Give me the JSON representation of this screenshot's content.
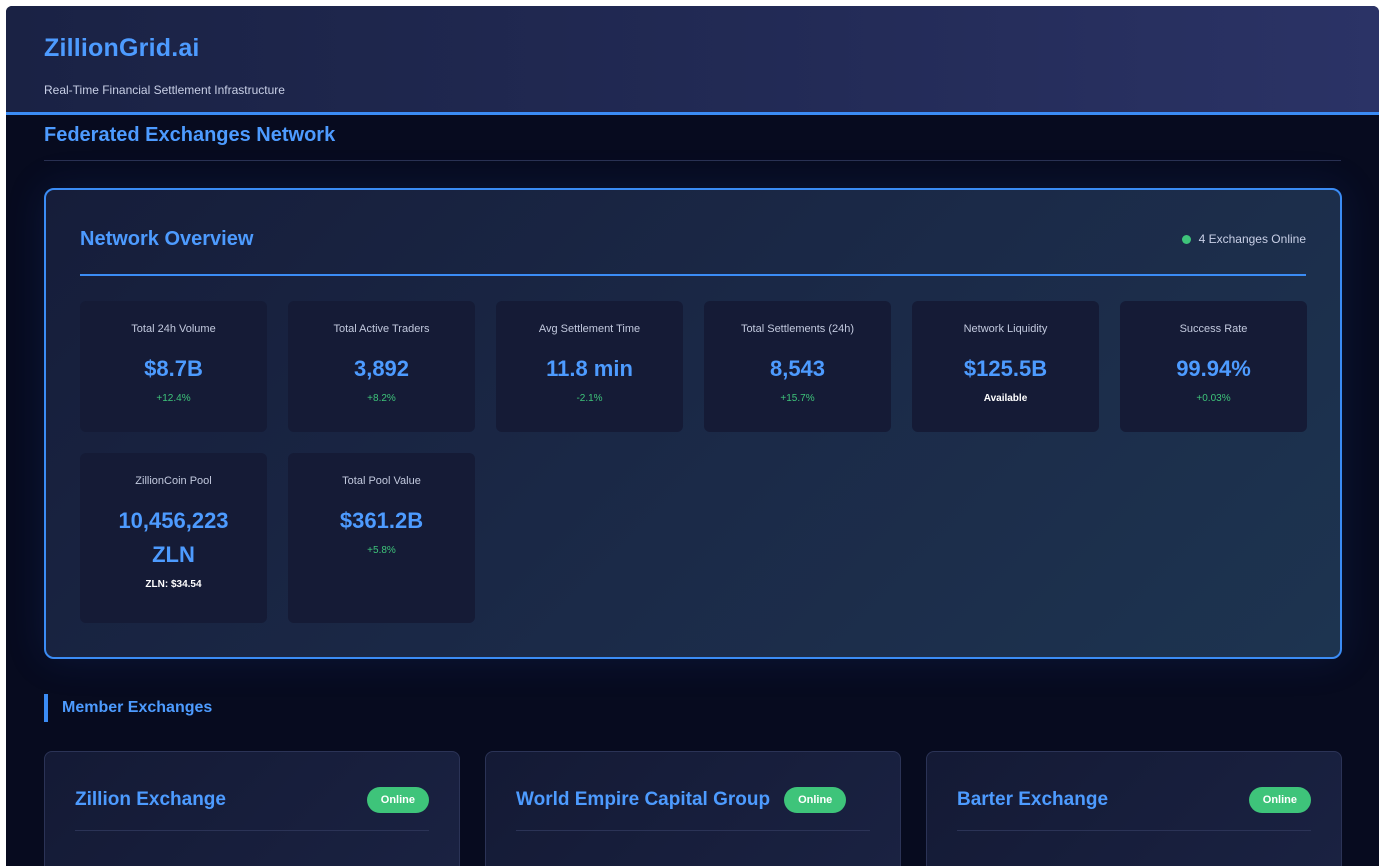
{
  "app": {
    "brand": "ZillionGrid.ai",
    "tagline": "Real-Time Financial Settlement Infrastructure"
  },
  "section": {
    "title": "Federated Exchanges Network"
  },
  "overview": {
    "title": "Network Overview",
    "status": "4 Exchanges Online",
    "status_color": "#3ec47a",
    "stats": [
      {
        "label": "Total 24h Volume",
        "value": "$8.7B",
        "change": "+12.4%"
      },
      {
        "label": "Total Active Traders",
        "value": "3,892",
        "change": "+8.2%"
      },
      {
        "label": "Avg Settlement Time",
        "value": "11.8 min",
        "change": "-2.1%"
      },
      {
        "label": "Total Settlements (24h)",
        "value": "8,543",
        "change": "+15.7%"
      },
      {
        "label": "Network Liquidity",
        "value": "$125.5B",
        "change": "Available"
      },
      {
        "label": "Success Rate",
        "value": "99.94%",
        "change": "+0.03%"
      },
      {
        "label": "ZillionCoin Pool",
        "value": "10,456,223 ZLN",
        "change": "ZLN: $34.54"
      },
      {
        "label": "Total Pool Value",
        "value": "$361.2B",
        "change": "+5.8%"
      }
    ]
  },
  "members": {
    "title": "Member Exchanges",
    "exchanges": [
      {
        "name": "Zillion Exchange",
        "status": "Online"
      },
      {
        "name": "World Empire Capital Group",
        "status": "Online"
      },
      {
        "name": "Barter Exchange",
        "status": "Online"
      }
    ]
  },
  "colors": {
    "accent": "#4d9bff",
    "border_accent": "#3b8cf5",
    "positive": "#3ec47a",
    "background": "#070b1f"
  }
}
